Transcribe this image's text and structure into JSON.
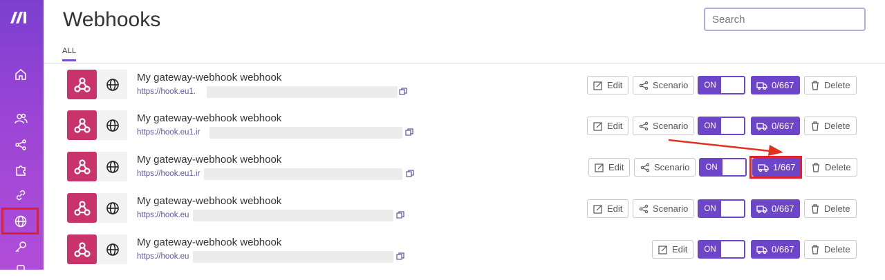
{
  "app": {
    "logo": "make-logo"
  },
  "sidebar": {
    "items": [
      {
        "name": "home",
        "icon": "home-icon"
      },
      {
        "name": "team",
        "icon": "users-icon"
      },
      {
        "name": "scenarios",
        "icon": "share-icon"
      },
      {
        "name": "apps",
        "icon": "puzzle-icon"
      },
      {
        "name": "connections",
        "icon": "link-icon"
      },
      {
        "name": "webhooks",
        "icon": "globe-icon",
        "active": true
      },
      {
        "name": "keys",
        "icon": "key-icon"
      }
    ]
  },
  "header": {
    "title": "Webhooks",
    "search_placeholder": "Search"
  },
  "tabs": [
    {
      "label": "ALL",
      "active": true
    }
  ],
  "webhooks": [
    {
      "name": "My gateway-webhook webhook",
      "url": "https://hook.eu1.",
      "edit": "Edit",
      "scenario": "Scenario",
      "toggle": "ON",
      "ops": "0/667",
      "delete": "Delete"
    },
    {
      "name": "My gateway-webhook webhook",
      "url": "https://hook.eu1.ir",
      "edit": "Edit",
      "scenario": "Scenario",
      "toggle": "ON",
      "ops": "0/667",
      "delete": "Delete"
    },
    {
      "name": "My gateway-webhook webhook",
      "url": "https://hook.eu1.ir",
      "edit": "Edit",
      "scenario": "Scenario",
      "toggle": "ON",
      "ops": "1/667",
      "delete": "Delete"
    },
    {
      "name": "My gateway-webhook webhook",
      "url": "https://hook.eu",
      "edit": "Edit",
      "scenario": "Scenario",
      "toggle": "ON",
      "ops": "0/667",
      "delete": "Delete"
    },
    {
      "name": "My gateway-webhook webhook",
      "url": "https://hook.eu",
      "edit": "Edit",
      "toggle": "ON",
      "ops": "0/667",
      "delete": "Delete"
    }
  ],
  "colors": {
    "accent": "#6d45c8",
    "app_icon": "#c8336a",
    "highlight": "#e0202a"
  }
}
